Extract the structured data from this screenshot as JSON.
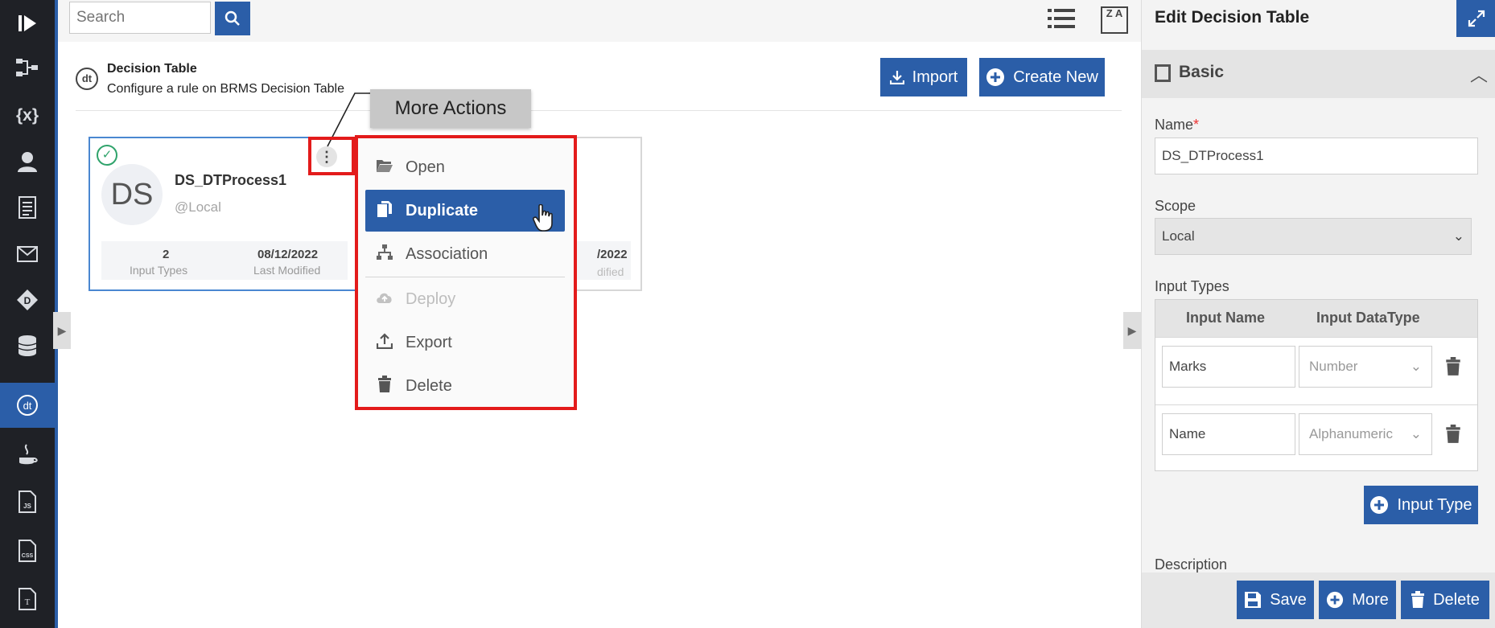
{
  "toolbar": {
    "search_placeholder": "Search",
    "sort_label": "Z A"
  },
  "header": {
    "icon_text": "dt",
    "title": "Decision Table",
    "subtitle": "Configure a rule on BRMS Decision Table",
    "import_label": "Import",
    "create_label": "Create New"
  },
  "card": {
    "avatar": "DS",
    "name": "DS_DTProcess1",
    "scope": "@Local",
    "input_types_value": "2",
    "input_types_label": "Input Types",
    "modified_value": "08/12/2022",
    "modified_label": "Last Modified"
  },
  "card2": {
    "modified_value": "/2022",
    "modified_label": "dified"
  },
  "tooltip": "More Actions",
  "menu": {
    "items": [
      {
        "label": "Open",
        "icon": "folder-open-icon",
        "state": "normal"
      },
      {
        "label": "Duplicate",
        "icon": "copy-icon",
        "state": "selected"
      },
      {
        "label": "Association",
        "icon": "hierarchy-icon",
        "state": "normal"
      },
      {
        "label": "Deploy",
        "icon": "cloud-upload-icon",
        "state": "disabled"
      },
      {
        "label": "Export",
        "icon": "upload-icon",
        "state": "normal"
      },
      {
        "label": "Delete",
        "icon": "trash-icon",
        "state": "normal"
      }
    ]
  },
  "panel": {
    "title": "Edit Decision Table",
    "section_title": "Basic",
    "name_label": "Name",
    "name_required": "*",
    "name_value": "DS_DTProcess1",
    "scope_label": "Scope",
    "scope_value": "Local",
    "input_types_label": "Input Types",
    "col_name": "Input Name",
    "col_type": "Input DataType",
    "rows": [
      {
        "name": "Marks",
        "type": "Number"
      },
      {
        "name": "Name",
        "type": "Alphanumeric"
      }
    ],
    "input_type_button": "Input Type",
    "description_label": "Description",
    "save_label": "Save",
    "more_label": "More",
    "delete_label": "Delete"
  },
  "colors": {
    "primary": "#2b5ea8",
    "rail": "#1f2126",
    "highlight": "#e31b1b",
    "success": "#2fa36b"
  }
}
